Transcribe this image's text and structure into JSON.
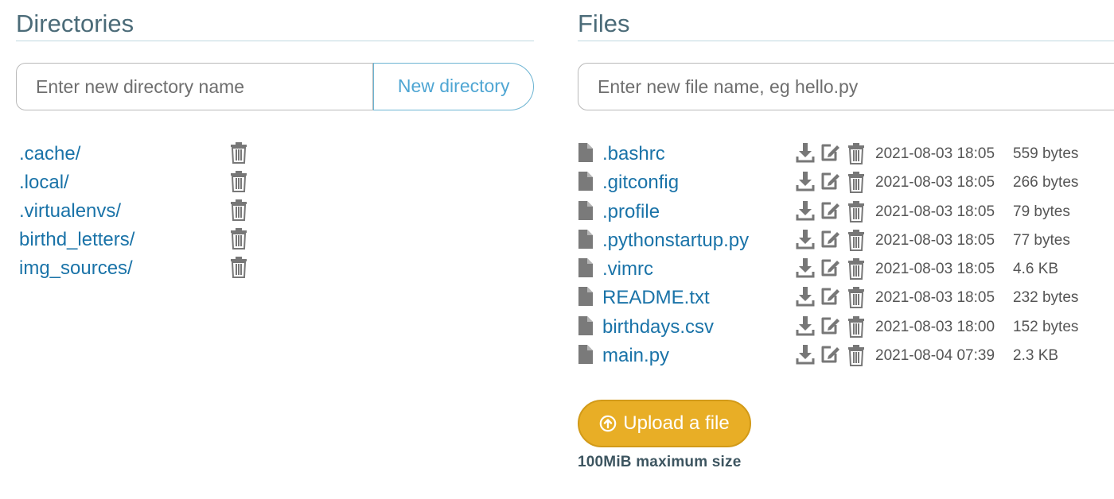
{
  "directories": {
    "title": "Directories",
    "input_placeholder": "Enter new directory name",
    "new_button_label": "New directory",
    "items": [
      {
        "name": ".cache/"
      },
      {
        "name": ".local/"
      },
      {
        "name": ".virtualenvs/"
      },
      {
        "name": "birthd_letters/"
      },
      {
        "name": "img_sources/"
      }
    ]
  },
  "files": {
    "title": "Files",
    "input_placeholder": "Enter new file name, eg hello.py",
    "items": [
      {
        "name": ".bashrc",
        "date": "2021-08-03 18:05",
        "size": "559 bytes"
      },
      {
        "name": ".gitconfig",
        "date": "2021-08-03 18:05",
        "size": "266 bytes"
      },
      {
        "name": ".profile",
        "date": "2021-08-03 18:05",
        "size": "79 bytes"
      },
      {
        "name": ".pythonstartup.py",
        "date": "2021-08-03 18:05",
        "size": "77 bytes"
      },
      {
        "name": ".vimrc",
        "date": "2021-08-03 18:05",
        "size": "4.6 KB"
      },
      {
        "name": "README.txt",
        "date": "2021-08-03 18:05",
        "size": "232 bytes"
      },
      {
        "name": "birthdays.csv",
        "date": "2021-08-03 18:00",
        "size": "152 bytes"
      },
      {
        "name": "main.py",
        "date": "2021-08-04 07:39",
        "size": "2.3 KB"
      }
    ],
    "upload_button_label": "Upload a file",
    "upload_note": "100MiB maximum size"
  },
  "icons": {
    "file": "file-icon",
    "download": "download-icon",
    "edit": "edit-icon",
    "delete": "trash-icon",
    "upload": "upload-circle-icon"
  },
  "colors": {
    "link": "#1a73a8",
    "title": "#4b6b78",
    "accent_button": "#e8ae26",
    "new_dir_button_text": "#4fa6d3"
  }
}
